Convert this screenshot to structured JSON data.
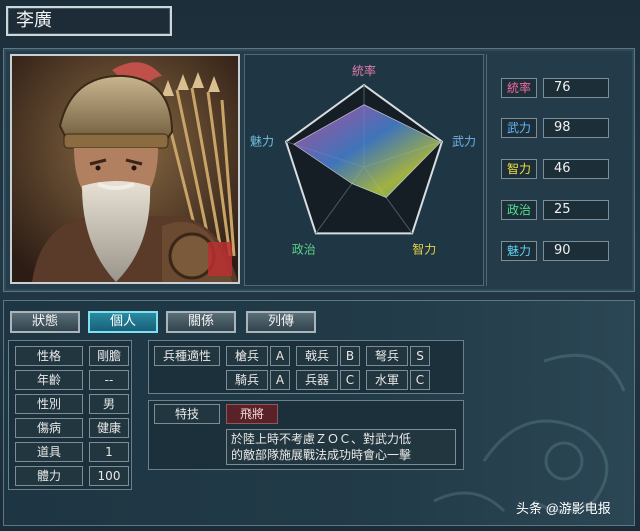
{
  "character": {
    "name": "李廣"
  },
  "radar": {
    "labels": {
      "command": "統率",
      "might": "武力",
      "intellect": "智力",
      "politics": "政治",
      "charisma": "魅力"
    },
    "values": [
      76,
      98,
      46,
      25,
      90
    ],
    "max": 100,
    "label_colors": {
      "command": "#e07aa8",
      "might": "#6fb0e8",
      "intellect": "#e6d24a",
      "politics": "#5ad088",
      "charisma": "#6fc0e0"
    }
  },
  "stats": [
    {
      "label": "統率",
      "value": "76",
      "color": "#f06aa0"
    },
    {
      "label": "武力",
      "value": "98",
      "color": "#66b6ff"
    },
    {
      "label": "智力",
      "value": "46",
      "color": "#f0e040"
    },
    {
      "label": "政治",
      "value": "25",
      "color": "#50e090"
    },
    {
      "label": "魅力",
      "value": "90",
      "color": "#60d0f0"
    }
  ],
  "tabs": [
    {
      "label": "狀態",
      "active": false
    },
    {
      "label": "個人",
      "active": true
    },
    {
      "label": "關係",
      "active": false
    },
    {
      "label": "列傳",
      "active": false
    }
  ],
  "info": [
    {
      "label": "性格",
      "value": "剛膽"
    },
    {
      "label": "年齡",
      "value": "--"
    },
    {
      "label": "性別",
      "value": "男"
    },
    {
      "label": "傷病",
      "value": "健康"
    },
    {
      "label": "道具",
      "value": "1"
    },
    {
      "label": "體力",
      "value": "100"
    }
  ],
  "troops": {
    "title": "兵種適性",
    "items": [
      {
        "name": "槍兵",
        "grade": "A"
      },
      {
        "name": "戟兵",
        "grade": "B"
      },
      {
        "name": "弩兵",
        "grade": "S"
      },
      {
        "name": "騎兵",
        "grade": "A"
      },
      {
        "name": "兵器",
        "grade": "C"
      },
      {
        "name": "水軍",
        "grade": "C"
      }
    ]
  },
  "skill": {
    "label": "特技",
    "name": "飛將",
    "description_line1": "於陸上時不考慮ＺＯＣ、對武力低",
    "description_line2": "的敵部隊施展戰法成功時會心一擊"
  },
  "watermark": "头条 @游影电报"
}
